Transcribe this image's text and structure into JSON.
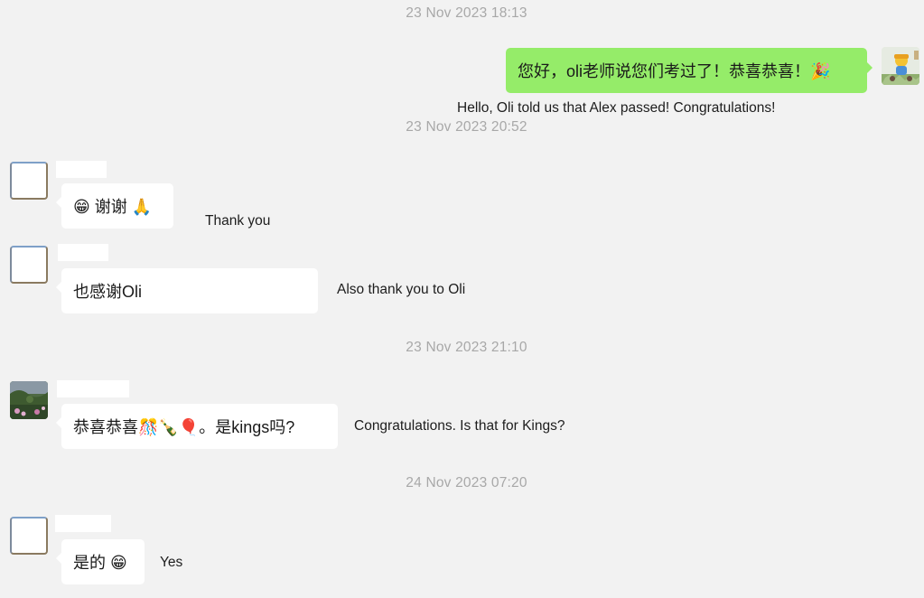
{
  "timestamps": [
    "23 Nov 2023 18:13",
    "23 Nov 2023 20:52",
    "23 Nov 2023 21:10",
    "24 Nov 2023 07:20"
  ],
  "messages": [
    {
      "sender": "me",
      "text": "您好，oli老师说您们考过了！恭喜恭喜！🎉",
      "translation": "Hello, Oli told us that Alex passed! Congratulations!",
      "avatar_icon": "cartoon-avatar-icon"
    },
    {
      "sender": "contact",
      "text": "😁 谢谢 🙏",
      "translation": "Thank you"
    },
    {
      "sender": "contact",
      "text": "也感谢Oli",
      "translation": "Also thank you to Oli"
    },
    {
      "sender": "contact",
      "text": "恭喜恭喜🎊🍾🎈。是kings吗?",
      "translation": "Congratulations. Is that for Kings?",
      "avatar_icon": "garden-photo-avatar-icon"
    },
    {
      "sender": "contact",
      "text": "是的 😁",
      "translation": "Yes"
    }
  ],
  "colors": {
    "background": "#f2f2f2",
    "my_bubble": "#95ec69",
    "their_bubble": "#ffffff",
    "timestamp_text": "#a8a8a8"
  }
}
